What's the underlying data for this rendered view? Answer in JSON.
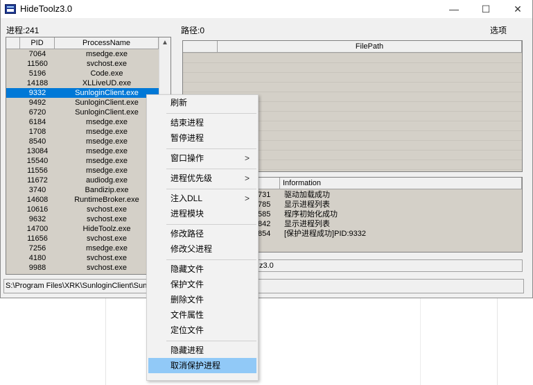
{
  "window": {
    "title": "HideToolz3.0",
    "min": "—",
    "max": "☐",
    "close": "✕"
  },
  "left": {
    "process_label": "进程:241",
    "columns": {
      "pid": "PID",
      "name": "ProcessName"
    },
    "scroll_up": "▲",
    "rows": [
      {
        "pid": "7064",
        "name": "msedge.exe"
      },
      {
        "pid": "11560",
        "name": "svchost.exe"
      },
      {
        "pid": "5196",
        "name": "Code.exe"
      },
      {
        "pid": "14188",
        "name": "XLLiveUD.exe"
      },
      {
        "pid": "9332",
        "name": "SunloginClient.exe"
      },
      {
        "pid": "9492",
        "name": "SunloginClient.exe"
      },
      {
        "pid": "6720",
        "name": "SunloginClient.exe"
      },
      {
        "pid": "6184",
        "name": "msedge.exe"
      },
      {
        "pid": "1708",
        "name": "msedge.exe"
      },
      {
        "pid": "8540",
        "name": "msedge.exe"
      },
      {
        "pid": "13084",
        "name": "msedge.exe"
      },
      {
        "pid": "15540",
        "name": "msedge.exe"
      },
      {
        "pid": "11556",
        "name": "msedge.exe"
      },
      {
        "pid": "11672",
        "name": "audiodg.exe"
      },
      {
        "pid": "3740",
        "name": "Bandizip.exe"
      },
      {
        "pid": "14608",
        "name": "RuntimeBroker.exe"
      },
      {
        "pid": "10616",
        "name": "svchost.exe"
      },
      {
        "pid": "9632",
        "name": "svchost.exe"
      },
      {
        "pid": "14700",
        "name": "HideToolz.exe"
      },
      {
        "pid": "11656",
        "name": "svchost.exe"
      },
      {
        "pid": "7256",
        "name": "msedge.exe"
      },
      {
        "pid": "4180",
        "name": "svchost.exe"
      },
      {
        "pid": "9988",
        "name": "svchost.exe"
      }
    ],
    "selected_index": 4
  },
  "right": {
    "path_label": "路径:0",
    "options": "选项",
    "filepath_header": "FilePath",
    "info_header": "Information",
    "log": [
      {
        "num": "731",
        "text": "驱动加载成功"
      },
      {
        "num": "785",
        "text": "显示进程列表"
      },
      {
        "num": "585",
        "text": "程序初始化成功"
      },
      {
        "num": "842",
        "text": "显示进程列表"
      },
      {
        "num": "854",
        "text": "[保护进程成功]PID:9332"
      }
    ],
    "log_status": "z3.0"
  },
  "statusbar": "S:\\Program Files\\XRK\\SunloginClient\\Sunlo",
  "menu": {
    "refresh": "刷新",
    "end_process": "结束进程",
    "pause_process": "暂停进程",
    "window_ops": "窗口操作",
    "priority": "进程优先级",
    "inject_dll": "注入DLL",
    "modules": "进程模块",
    "modify_path": "修改路径",
    "modify_parent": "修改父进程",
    "hide_file": "隐藏文件",
    "protect_file": "保护文件",
    "delete_file": "删除文件",
    "file_props": "文件属性",
    "locate_file": "定位文件",
    "hide_process": "隐藏进程",
    "unprotect_process": "取消保护进程",
    "submenu_arrow": ">"
  },
  "colors": {
    "selection": "#0078d7",
    "menu_highlight": "#91c9f7",
    "table_bg": "#d4d0c8"
  }
}
